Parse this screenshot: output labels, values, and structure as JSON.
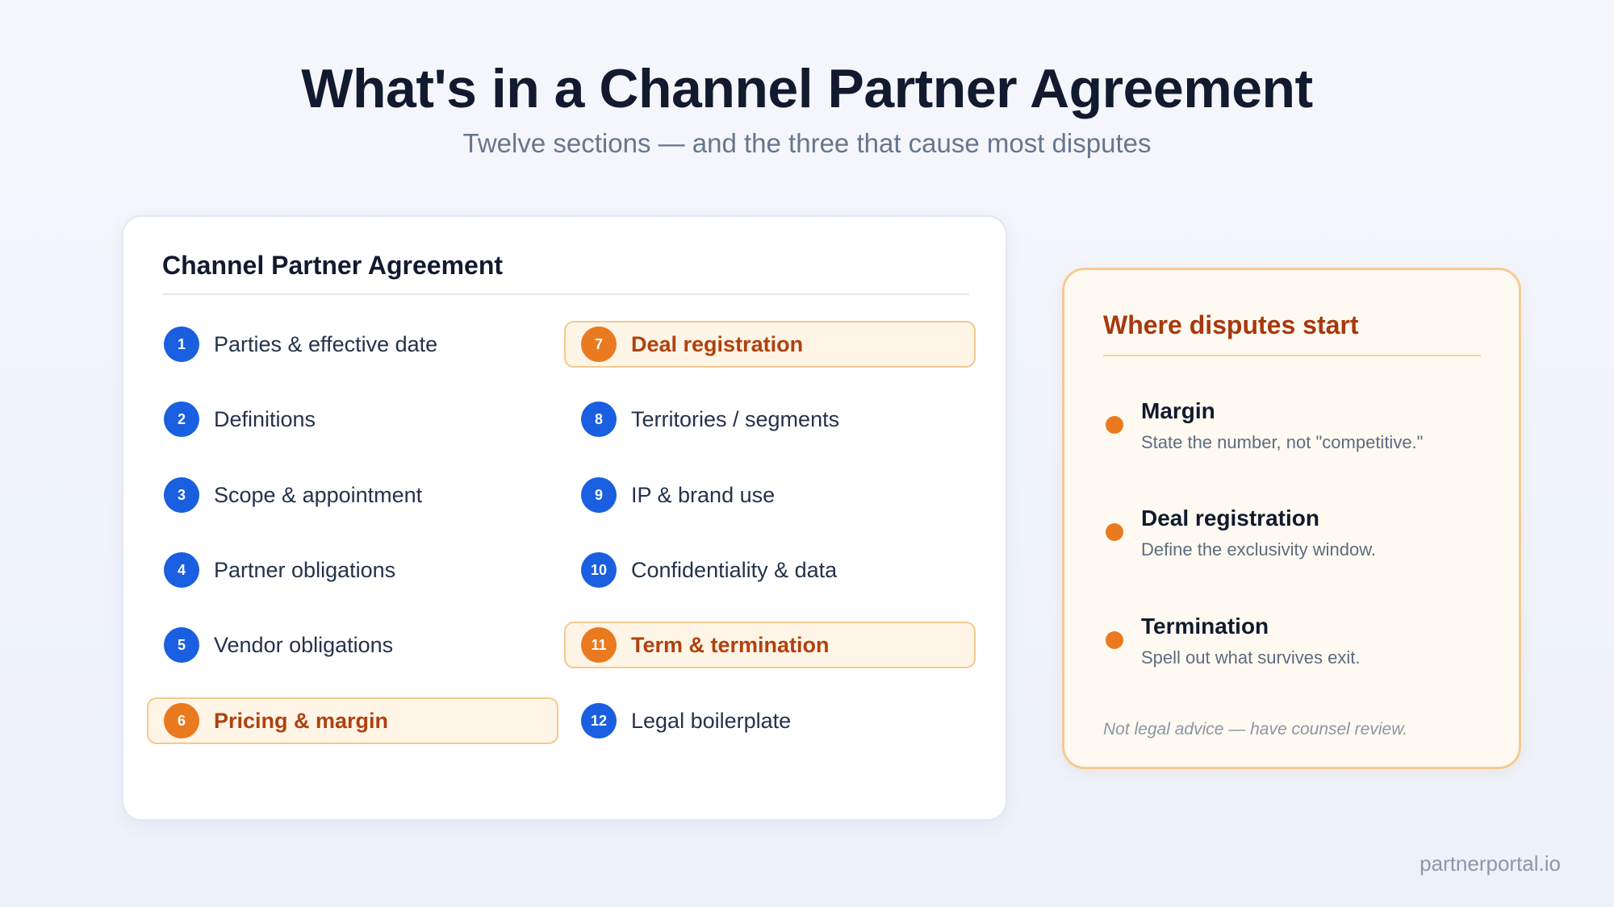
{
  "title": "What's in a Channel Partner Agreement",
  "subtitle": "Twelve sections — and the three that cause most disputes",
  "agreement": {
    "heading": "Channel Partner Agreement",
    "sections": [
      {
        "number": "1",
        "label": "Parties & effective date",
        "highlighted": false
      },
      {
        "number": "2",
        "label": "Definitions",
        "highlighted": false
      },
      {
        "number": "3",
        "label": "Scope & appointment",
        "highlighted": false
      },
      {
        "number": "4",
        "label": "Partner obligations",
        "highlighted": false
      },
      {
        "number": "5",
        "label": "Vendor obligations",
        "highlighted": false
      },
      {
        "number": "6",
        "label": "Pricing & margin",
        "highlighted": true
      },
      {
        "number": "7",
        "label": "Deal registration",
        "highlighted": true
      },
      {
        "number": "8",
        "label": "Territories / segments",
        "highlighted": false
      },
      {
        "number": "9",
        "label": "IP & brand use",
        "highlighted": false
      },
      {
        "number": "10",
        "label": "Confidentiality & data",
        "highlighted": false
      },
      {
        "number": "11",
        "label": "Term & termination",
        "highlighted": true
      },
      {
        "number": "12",
        "label": "Legal boilerplate",
        "highlighted": false
      }
    ]
  },
  "disputes": {
    "heading": "Where disputes start",
    "points": [
      {
        "name": "Margin",
        "description": "State the number, not \"competitive.\""
      },
      {
        "name": "Deal registration",
        "description": "Define the exclusivity window."
      },
      {
        "name": "Termination",
        "description": "Spell out what survives exit."
      }
    ],
    "note": "Not legal advice — have counsel review."
  },
  "brand": "partnerportal.io",
  "colors": {
    "accent_blue": "#1a5fe0",
    "highlight_orange": "#ea7a1f",
    "highlight_text": "#b0410f",
    "highlight_fill": "#fff5e6"
  }
}
